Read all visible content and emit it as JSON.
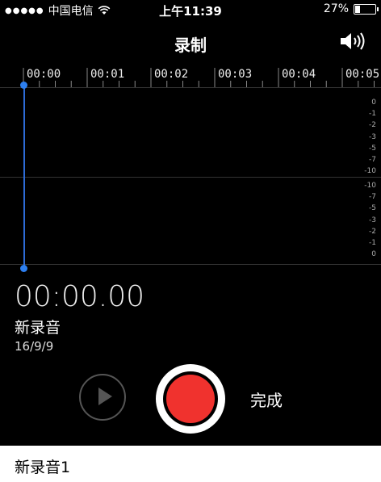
{
  "status_bar": {
    "carrier": "中国电信",
    "time": "上午11:39",
    "battery_text": "27%",
    "battery_level": 0.27,
    "signal_icon": "signal-dots-icon",
    "wifi_icon": "wifi-icon"
  },
  "nav": {
    "title": "录制",
    "speaker_icon": "speaker-icon"
  },
  "timeline": {
    "ticks": [
      "00:00",
      "00:01",
      "00:02",
      "00:03",
      "00:04",
      "00:05"
    ],
    "db_top": [
      "0",
      "-1",
      "-2",
      "-3",
      "-5",
      "-7",
      "-10"
    ],
    "db_bottom": [
      "-10",
      "-7",
      "-5",
      "-3",
      "-2",
      "-1",
      "0"
    ]
  },
  "recording": {
    "elapsed": "00:00.00",
    "name": "新录音",
    "date": "16/9/9"
  },
  "controls": {
    "play_icon": "play-icon",
    "record_icon": "record-icon",
    "done_label": "完成"
  },
  "list": {
    "first_item_title": "新录音1"
  },
  "colors": {
    "background": "#000000",
    "record_red": "#f0322e",
    "playhead_blue": "#2d7ff0"
  }
}
